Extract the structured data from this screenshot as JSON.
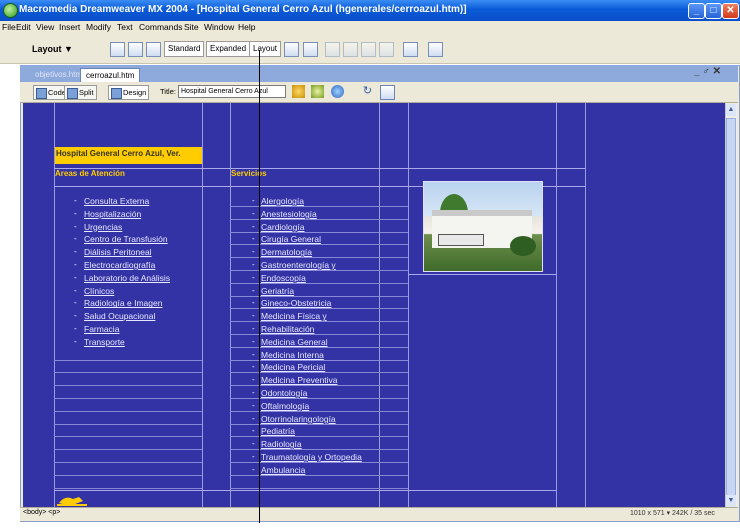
{
  "app": {
    "title": "Macromedia Dreamweaver MX 2004 - [Hospital General Cerro Azul (hgenerales/cerroazul.htm)]",
    "window_buttons": {
      "minimize": "_",
      "maximize": "□",
      "close": "✕"
    }
  },
  "menu": [
    "File",
    "Edit",
    "View",
    "Insert",
    "Modify",
    "Text",
    "Commands",
    "Site",
    "Window",
    "Help"
  ],
  "insert_bar": {
    "category": "Layout ▼",
    "modes": [
      "Standard",
      "Expanded",
      "Layout"
    ]
  },
  "document": {
    "tabs": [
      "objetivos.htm",
      "cerroazul.htm"
    ],
    "window_controls": "_ ♂ ✕",
    "views": [
      "Code",
      "Split",
      "Design"
    ],
    "title_label": "Title:",
    "title_value": "Hospital General Cerro Azul"
  },
  "page": {
    "hospital_name": "Hospital General Cerro Azul, Ver.",
    "areas_heading": "Areas de Atención",
    "areas": [
      "Consulta Externa",
      "Hospitalización",
      "Urgencias",
      "Centro de Transfusión",
      "Diálisis Peritoneal",
      "Electrocardiografía",
      "Laboratorio de Análisis",
      "Clínicos",
      "Radiología e Imagen",
      "Salud Ocupacional",
      "Farmacia",
      "Transporte"
    ],
    "services_heading": "Servicios",
    "services": [
      "Alergología",
      "Anestesiología",
      "Cardiología",
      "Cirugía General",
      "Dermatología",
      "Gastroenterología y",
      "Endoscopía",
      "Geriatría",
      "Gineco-Obstetricia",
      "Medicina Física y",
      "Rehabilitación",
      "Medicina General",
      "Medicina Interna",
      "Medicina Pericial",
      "Medicina Preventiva",
      "Odontología",
      "Oftalmología",
      "Otorrinolaringología",
      "Pediatría",
      "Radiología",
      "Traumatología y Ortopedia",
      "Ambulancia"
    ],
    "bullet": "-"
  },
  "status": {
    "tag_selector": "<body> <p>",
    "right": "1010 x 571 ▾ 242K / 35 sec"
  }
}
